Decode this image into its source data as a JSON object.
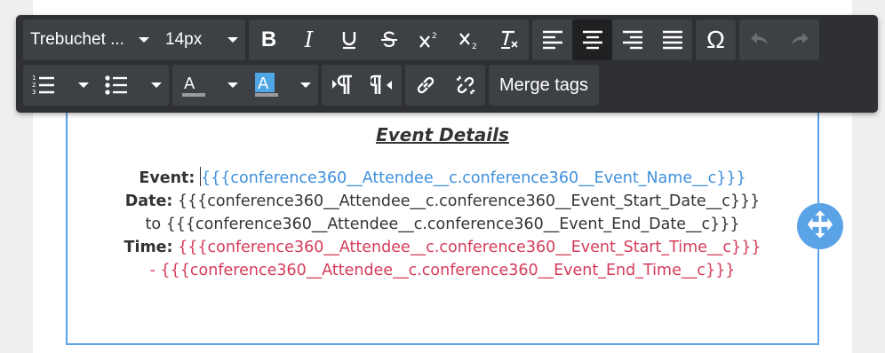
{
  "toolbar": {
    "font_family": "Trebuchet ...",
    "font_size": "14px",
    "merge_tags_label": "Merge tags"
  },
  "content": {
    "heading": "Event Details",
    "event_label": "Event:",
    "event_value": "{{{conference360__Attendee__c.conference360__Event_Name__c}}}",
    "date_label": "Date:",
    "date_start_value": "{{{conference360__Attendee__c.conference360__Event_Start_Date__c}}}",
    "date_to": "to",
    "date_end_value": "{{{conference360__Attendee__c.conference360__Event_End_Date__c}}}",
    "time_label": "Time:",
    "time_start_value": "{{{conference360__Attendee__c.conference360__Event_Start_Time__c}}}",
    "time_dash": "-",
    "time_end_value": "{{{conference360__Attendee__c.conference360__Event_End_Time__c}}}"
  },
  "colors": {
    "accent_blue": "#3e8fdc",
    "accent_red": "#d43b5a",
    "frame_border": "#5aa3e6",
    "toolbar_bg": "#2e3033"
  }
}
